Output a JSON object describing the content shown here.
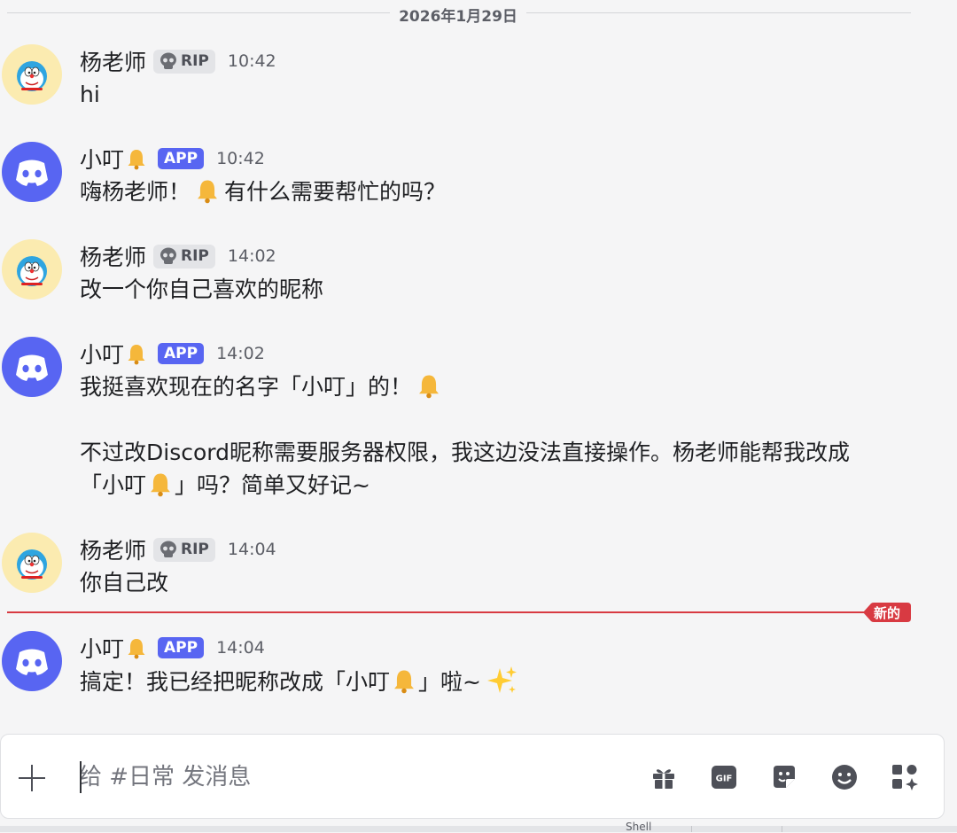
{
  "date_divider": "2026年1月29日",
  "new_divider_label": "新的",
  "messages": [
    {
      "author": "杨老师",
      "role_tag": "RIP",
      "time": "10:42",
      "lines": [
        "hi"
      ]
    },
    {
      "author": "小叮",
      "app_tag": "APP",
      "time": "10:42",
      "text_before": "嗨杨老师！",
      "text_after": "有什么需要帮忙的吗？"
    },
    {
      "author": "杨老师",
      "role_tag": "RIP",
      "time": "14:02",
      "lines": [
        "改一个你自己喜欢的昵称"
      ]
    },
    {
      "author": "小叮",
      "app_tag": "APP",
      "time": "14:02",
      "line1": "我挺喜欢现在的名字「小叮」的！",
      "line2": "不过改Discord昵称需要服务器权限，我这边没法直接操作。杨老师能帮我改成",
      "line3_before": "「小叮",
      "line3_after": "」吗？简单又好记~"
    },
    {
      "author": "杨老师",
      "role_tag": "RIP",
      "time": "14:04",
      "lines": [
        "你自己改"
      ]
    },
    {
      "author": "小叮",
      "app_tag": "APP",
      "time": "14:04",
      "text_before": "搞定！我已经把昵称改成「小叮",
      "text_after": "」啦~"
    }
  ],
  "composer": {
    "placeholder": "给 #日常 发消息",
    "tools": [
      "gift-icon",
      "gif-icon",
      "sticker-icon",
      "emoji-icon",
      "apps-icon"
    ]
  },
  "bottom_partial_text": "Shell",
  "colors": {
    "blurple": "#5865f2",
    "new_red": "#d83a42",
    "avatar_yellow": "#fbebb0"
  }
}
